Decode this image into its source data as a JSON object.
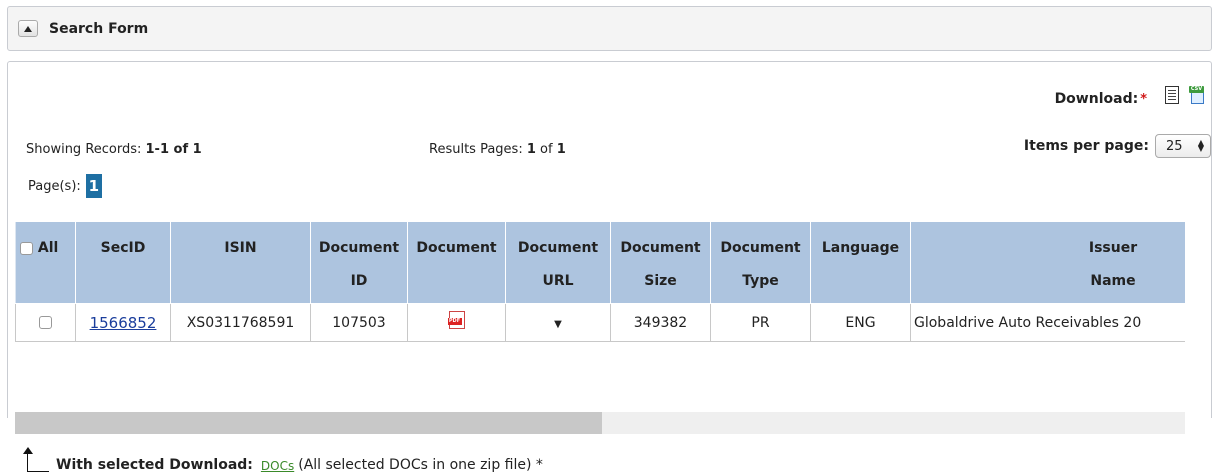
{
  "search_form": {
    "label": "Search Form"
  },
  "download": {
    "label": "Download:",
    "required_mark": "*"
  },
  "showing": {
    "prefix": "Showing Records: ",
    "value": "1-1 of 1"
  },
  "results_pages": {
    "prefix": "Results Pages: ",
    "current": "1",
    "sep": " of ",
    "total": "1"
  },
  "items_per_page": {
    "label": "Items per page:",
    "value": "25"
  },
  "pages": {
    "label": "Page(s):",
    "current": "1"
  },
  "table": {
    "headers": [
      {
        "line1": "All",
        "line2": ""
      },
      {
        "line1": "SecID",
        "line2": ""
      },
      {
        "line1": "ISIN",
        "line2": ""
      },
      {
        "line1": "Document",
        "line2": "ID"
      },
      {
        "line1": "Document",
        "line2": ""
      },
      {
        "line1": "Document",
        "line2": "URL"
      },
      {
        "line1": "Document",
        "line2": "Size"
      },
      {
        "line1": "Document",
        "line2": "Type"
      },
      {
        "line1": "Language",
        "line2": ""
      },
      {
        "line1": "Issuer",
        "line2": "Name"
      }
    ],
    "rows": [
      {
        "secid": "1566852",
        "isin": "XS0311768591",
        "doc_id": "107503",
        "doc_size": "349382",
        "doc_type": "PR",
        "language": "ENG",
        "issuer_name": "Globaldrive Auto Receivables 20"
      }
    ]
  },
  "footer": {
    "with_selected": "With selected Download:",
    "docs_link": "DOCs",
    "note": "(All selected DOCs in one zip file) *"
  },
  "colors": {
    "header_bg": "#adc4df",
    "page_badge": "#1e6fa3",
    "link": "#1a3d9c",
    "docs_link": "#3a8a2a",
    "required": "#d01818"
  }
}
